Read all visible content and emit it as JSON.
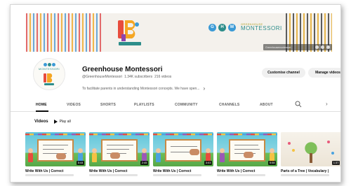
{
  "banner": {
    "brand_small": "GREENHOUSE",
    "brand_name": "MONTESSORI",
    "monogram": [
      "G",
      "H",
      "M"
    ],
    "link_text": "Greenhousemontessori",
    "colors": {
      "dot1": "#3b9ad6",
      "dot2": "#2d8d8a",
      "dot3": "#3b9ad6"
    }
  },
  "channel": {
    "name": "Greenhouse Montessori",
    "handle": "@GreenhouseMontessori",
    "subscribers": "1.34K subscribers",
    "video_count": "216 videos",
    "description": "To facilitate parents in understanding Montessori concepts. We have spen...",
    "avatar_label": "MONTESSORI"
  },
  "buttons": {
    "customise": "Customise channel",
    "manage": "Manage videos"
  },
  "tabs": [
    {
      "label": "HOME",
      "active": true
    },
    {
      "label": "VIDEOS",
      "active": false
    },
    {
      "label": "SHORTS",
      "active": false
    },
    {
      "label": "PLAYLISTS",
      "active": false
    },
    {
      "label": "COMMUNITY",
      "active": false
    },
    {
      "label": "CHANNELS",
      "active": false
    },
    {
      "label": "ABOUT",
      "active": false
    }
  ],
  "section": {
    "title": "Videos",
    "play_all": "Play all"
  },
  "videos": [
    {
      "title": "Write With Us | Correct",
      "duration": "5:44"
    },
    {
      "title": "Write With Us | Correct",
      "duration": "2:45"
    },
    {
      "title": "Write With Us | Correct",
      "duration": "3:03"
    },
    {
      "title": "Write With Us | Correct",
      "duration": "5:08"
    },
    {
      "title": "Parts of a Tree | Vocabulary |",
      "duration": "1:37"
    }
  ]
}
